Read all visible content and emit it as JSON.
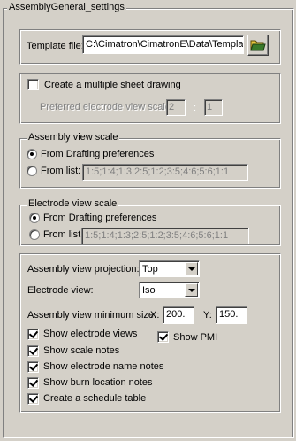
{
  "dialog": {
    "title": "AssemblyGeneral_settings"
  },
  "template": {
    "label": "Template file:",
    "value": "C:\\Cimatron\\CimatronE\\Data\\Template"
  },
  "multi_sheet": {
    "checkbox_label": "Create a multiple sheet drawing",
    "checked": false,
    "scale_label": "Preferred electrode view scale:",
    "scale_numerator": "2",
    "scale_separator": ":",
    "scale_denominator": "1"
  },
  "assembly_scale": {
    "title": "Assembly view scale",
    "option_drafting": "From Drafting preferences",
    "option_list": "From list:",
    "selected": "drafting",
    "list_value": "1:5;1:4;1:3;2:5;1:2;3:5;4:6;5:6;1:1"
  },
  "electrode_scale": {
    "title": "Electrode view scale",
    "option_drafting": "From Drafting preferences",
    "option_list": "From list:",
    "selected": "drafting",
    "list_value": "1:5;1:4;1:3;2:5;1:2;3:5;4:6;5:6;1:1"
  },
  "settings": {
    "projection_label": "Assembly view projection:",
    "projection_value": "Top",
    "electrode_view_label": "Electrode view:",
    "electrode_view_value": "Iso",
    "min_size_label": "Assembly view minimum size:",
    "x_label": "X:",
    "x_value": "200.",
    "y_label": "Y:",
    "y_value": "150.",
    "checkboxes": [
      {
        "label": "Show electrode views",
        "checked": true
      },
      {
        "label": "Show PMI",
        "checked": true
      },
      {
        "label": "Show scale notes",
        "checked": true
      },
      {
        "label": "Show electrode name notes",
        "checked": true
      },
      {
        "label": "Show burn location notes",
        "checked": true
      },
      {
        "label": "Create a schedule table",
        "checked": true
      }
    ]
  }
}
